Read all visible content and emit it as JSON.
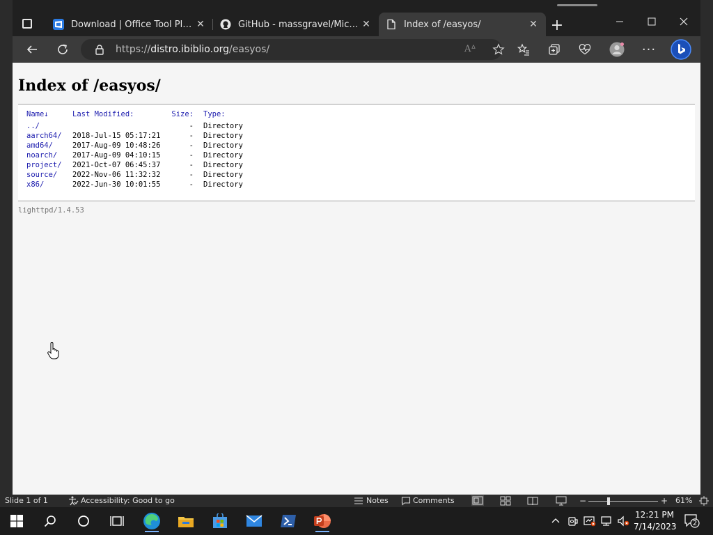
{
  "browser": {
    "tabs": [
      {
        "label": "Download | Office Tool Plus Website",
        "icon": "windows-app-icon"
      },
      {
        "label": "GitHub - massgravel/Microsoft-Activation-Scripts",
        "icon": "github-icon"
      },
      {
        "label": "Index of /easyos/",
        "icon": "page-icon",
        "active": true
      }
    ],
    "address": {
      "scheme": "https://",
      "host": "distro.ibiblio.org",
      "path": "/easyos/"
    }
  },
  "page": {
    "title": "Index of /easyos/",
    "columns": {
      "name": "Name↓",
      "modified": "Last Modified:",
      "size": "Size:",
      "type": "Type:"
    },
    "rows": [
      {
        "name": "../",
        "modified": "",
        "size": "-",
        "type": "Directory"
      },
      {
        "name": "aarch64/",
        "modified": "2018-Jul-15 05:17:21",
        "size": "-",
        "type": "Directory"
      },
      {
        "name": "amd64/",
        "modified": "2017-Aug-09 10:48:26",
        "size": "-",
        "type": "Directory"
      },
      {
        "name": "noarch/",
        "modified": "2017-Aug-09 04:10:15",
        "size": "-",
        "type": "Directory"
      },
      {
        "name": "project/",
        "modified": "2021-Oct-07 06:45:37",
        "size": "-",
        "type": "Directory"
      },
      {
        "name": "source/",
        "modified": "2022-Nov-06 11:32:32",
        "size": "-",
        "type": "Directory"
      },
      {
        "name": "x86/",
        "modified": "2022-Jun-30 10:01:55",
        "size": "-",
        "type": "Directory"
      }
    ],
    "footer": "lighttpd/1.4.53"
  },
  "statusbar": {
    "slide": "Slide 1 of 1",
    "accessibility": "Accessibility: Good to go",
    "notes": "Notes",
    "comments": "Comments",
    "zoom": "61%"
  },
  "taskbar": {
    "time": "12:21 PM",
    "date": "7/14/2023",
    "notifications": "2"
  },
  "colors": {
    "link": "#1c1cae",
    "chrome_dark": "#202020",
    "toolbar": "#3b3b3b",
    "accent": "#0a64c8"
  }
}
